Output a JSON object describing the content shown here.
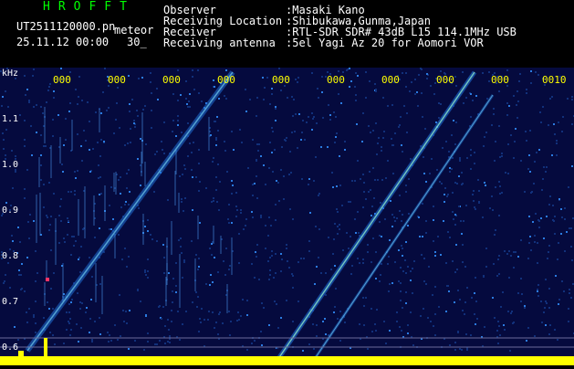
{
  "header": {
    "title": "HROFFT",
    "filename": "UT2511120000.pn",
    "kind": "meteor",
    "date": "25.11.12 00:00",
    "duration": "30_"
  },
  "info": [
    {
      "label": "Observer",
      "value": ":Masaki Kano"
    },
    {
      "label": "Receiving Location",
      "value": ":Shibukawa,Gunma,Japan"
    },
    {
      "label": "Receiver",
      "value": ":RTL-SDR SDR# 43dB L15 114.1MHz USB"
    },
    {
      "label": "Receiving antenna",
      "value": ":5el Yagi Az 20 for Aomori VOR"
    }
  ],
  "axis": {
    "unit": "kHz",
    "y_ticks": [
      "1.1",
      "1.0",
      "0.9",
      "0.8",
      "0.7",
      "0.6"
    ],
    "x_ticks": [
      "000",
      "000",
      "000",
      "000",
      "000",
      "000",
      "000",
      "000",
      "000",
      "0010"
    ]
  },
  "colors": {
    "background": "#000000",
    "spectrum_bg": "#050a3e",
    "title": "#00ff00",
    "text": "#ffffff",
    "ticks": "#ffff00"
  }
}
